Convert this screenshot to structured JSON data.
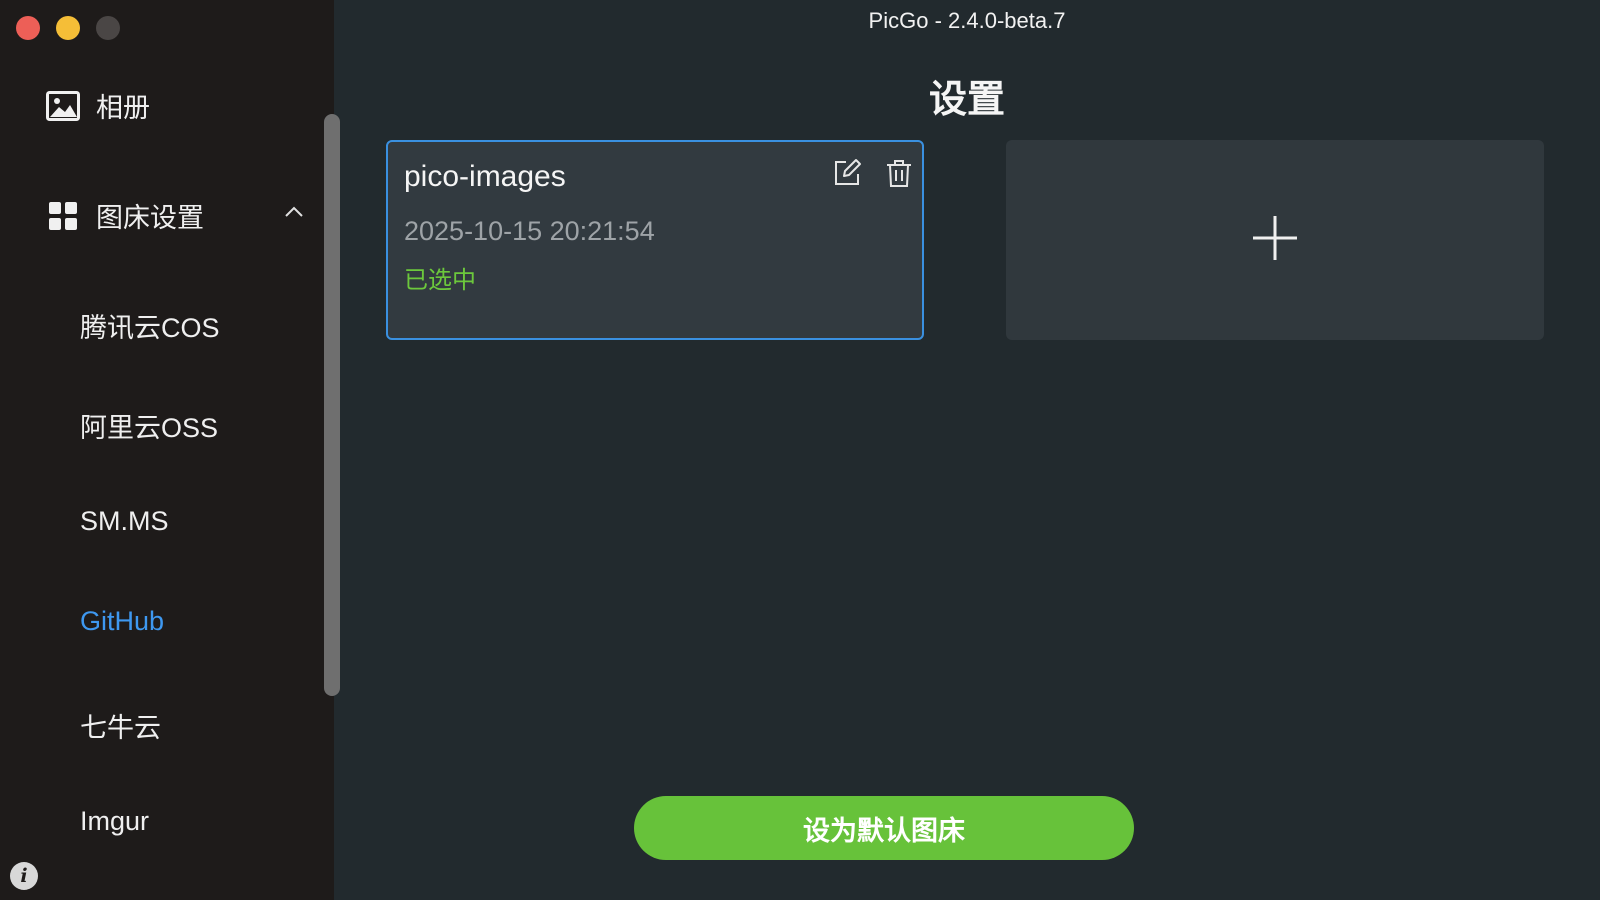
{
  "window": {
    "title": "PicGo - 2.4.0-beta.7"
  },
  "sidebar": {
    "album_label": "相册",
    "picbed_label": "图床设置",
    "items": [
      {
        "label": "腾讯云COS"
      },
      {
        "label": "阿里云OSS"
      },
      {
        "label": "SM.MS"
      },
      {
        "label": "GitHub"
      },
      {
        "label": "七牛云"
      },
      {
        "label": "Imgur"
      }
    ],
    "active_item": "GitHub"
  },
  "main": {
    "page_title": "设置",
    "config_card": {
      "name": "pico-images",
      "date": "2025-10-15 20:21:54",
      "status": "已选中"
    },
    "default_button_label": "设为默认图床"
  },
  "colors": {
    "accent_blue": "#3e98f0",
    "success_green": "#67c23a",
    "sidebar_bg": "#1e1b1a",
    "main_bg": "#222a2e"
  },
  "icons": {
    "album": "image-icon",
    "picbed": "grid-icon",
    "edit": "edit-icon",
    "delete": "trash-icon",
    "add": "plus-icon",
    "info": "info-icon"
  }
}
